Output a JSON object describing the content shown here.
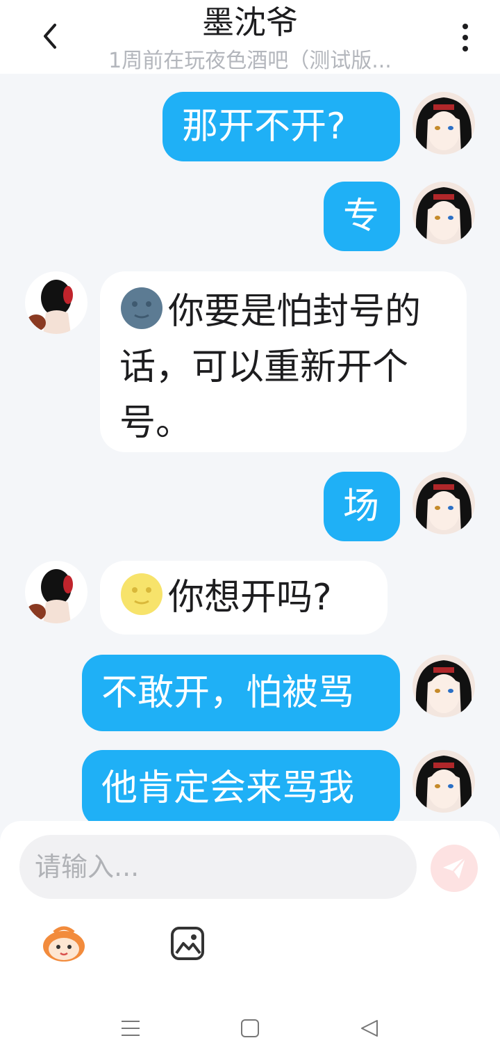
{
  "header": {
    "title": "墨沈爷",
    "subtitle": "1周前在玩夜色酒吧（测试版..."
  },
  "messages": [
    {
      "side": "out",
      "text": "那开不开?"
    },
    {
      "side": "out",
      "text": "专"
    },
    {
      "side": "in",
      "emoji": "new-moon-face-emoji",
      "text": "你要是怕封号的话，可以重新开个号。"
    },
    {
      "side": "out",
      "text": "场"
    },
    {
      "side": "in",
      "emoji": "full-moon-face-emoji",
      "text": "你想开吗?"
    },
    {
      "side": "out",
      "text": "不敢开，怕被骂"
    },
    {
      "side": "out",
      "text": "他肯定会来骂我"
    }
  ],
  "composer": {
    "placeholder": "请输入..."
  },
  "colors": {
    "outgoing_bubble": "#1fb0f6",
    "incoming_bubble": "#ffffff",
    "send_button": "#fde2e2",
    "background": "#f4f6f9"
  }
}
